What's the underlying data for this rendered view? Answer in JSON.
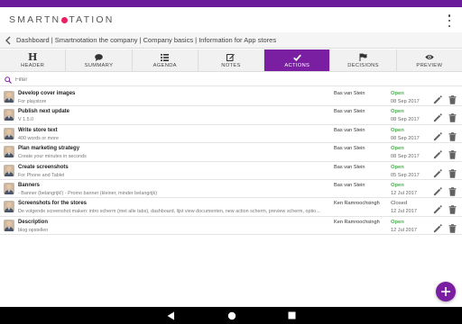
{
  "app": {
    "logo_left": "SMARTN",
    "logo_right": "TATION"
  },
  "breadcrumb": {
    "text": "Dashboard | Smartnotation the company | Company basics | Information for App stores"
  },
  "tabs": [
    {
      "label": "HEADER",
      "icon": "header-icon"
    },
    {
      "label": "SUMMARY",
      "icon": "chat-icon"
    },
    {
      "label": "AGENDA",
      "icon": "list-icon"
    },
    {
      "label": "NOTES",
      "icon": "edit-icon"
    },
    {
      "label": "ACTIONS",
      "icon": "check-icon"
    },
    {
      "label": "DECISIONS",
      "icon": "flag-icon"
    },
    {
      "label": "PREVIEW",
      "icon": "eye-icon"
    }
  ],
  "filter": {
    "placeholder": "Filter"
  },
  "actions": [
    {
      "title": "Develop cover images",
      "description": "For playstore",
      "assignee": "Bas van Stein",
      "status": "Open",
      "date": "08 Sep 2017"
    },
    {
      "title": "Publish next update",
      "description": "V 1.5.0",
      "assignee": "Bas van Stein",
      "status": "Open",
      "date": "08 Sep 2017"
    },
    {
      "title": "Write store text",
      "description": "400 words or more",
      "assignee": "Bas van Stein",
      "status": "Open",
      "date": "08 Sep 2017"
    },
    {
      "title": "Plan marketing strategy",
      "description": "Create your minutes in seconds",
      "assignee": "Bas van Stein",
      "status": "Open",
      "date": "08 Sep 2017"
    },
    {
      "title": "Create screenshots",
      "description": "For Phone and Tablet",
      "assignee": "Bas van Stein",
      "status": "Open",
      "date": "05 Sep 2017"
    },
    {
      "title": "Banners",
      "description": "- Banner (belangrijk!) - Promo banner (kleiner, minder belangrijk)",
      "assignee": "Bas van Stein",
      "status": "Open",
      "date": "12 Jul 2017"
    },
    {
      "title": "Screenshots for the stores",
      "description": "De volgende screenshot maken: intro scherm (met alle tabs), dashboard, lijst view documenten, new action scherm, preview scherm, optio...",
      "assignee": "Ken Ramroochsingh",
      "status": "Closed",
      "date": "12 Jul 2017"
    },
    {
      "title": "Description",
      "description": "blog opstellen",
      "assignee": "Ken Ramroochsingh",
      "status": "Open",
      "date": "12 Jul 2017"
    }
  ],
  "colors": {
    "brand": "#7b1fa2",
    "status_bar": "#6a1b9a",
    "logo_dot": "#e91e63",
    "open": "#4caf50"
  }
}
